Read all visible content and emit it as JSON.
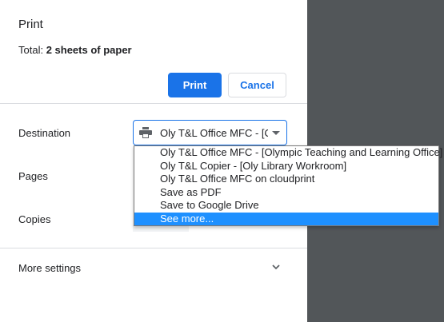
{
  "header": {
    "title": "Print",
    "total_prefix": "Total: ",
    "total_value": "2 sheets of paper"
  },
  "actions": {
    "print_label": "Print",
    "cancel_label": "Cancel"
  },
  "settings": {
    "destination_label": "Destination",
    "destination_value": "Oly T&L Office MFC - [Olympic Teaching and Learning Office]",
    "pages_label": "Pages",
    "copies_label": "Copies",
    "more_settings_label": "More settings"
  },
  "dropdown": {
    "options": [
      "Oly T&L Office MFC - [Olympic Teaching and Learning Office]",
      "Oly T&L Copier - [Oly Library Workroom]",
      "Oly T&L Office MFC on cloudprint",
      "Save as PDF",
      "Save to Google Drive",
      "See more..."
    ],
    "highlighted_option": "See more..."
  },
  "icons": {
    "destination_icon": "printer-icon",
    "select_arrow": "caret-down-icon",
    "more_settings_icon": "chevron-down-icon"
  },
  "colors": {
    "accent": "#1a73e8",
    "selected_option_bg": "#1e90ff",
    "preview_bg": "#525659"
  }
}
